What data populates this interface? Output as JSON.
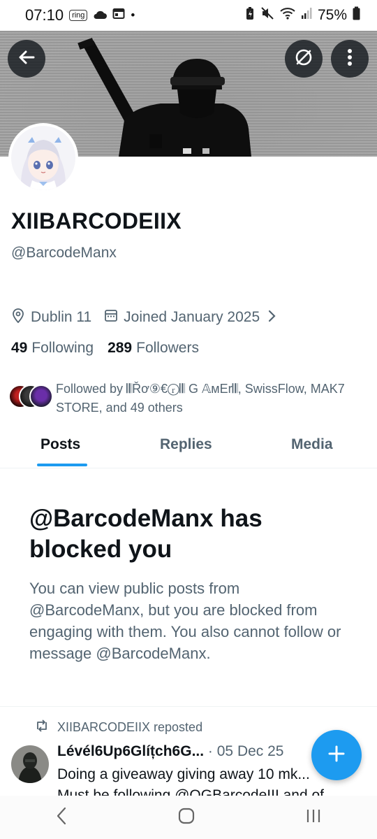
{
  "status_bar": {
    "time": "07:10",
    "ring_badge": "ring",
    "dot": "•",
    "battery": "75%",
    "icons": [
      "cloud-icon",
      "calendar-icon",
      "battery-saver-icon",
      "mute-icon",
      "wifi-icon",
      "signal-icon",
      "battery-icon"
    ]
  },
  "profile": {
    "name": "XIIBARCODEIIX",
    "handle": "@BarcodeManx",
    "location": "Dublin 11",
    "joined": "Joined January 2025",
    "following_count": "49",
    "following_label": "Following",
    "followers_count": "289",
    "followers_label": "Followers",
    "followed_by": "Followed by 𝄃𝄃Řơ⑨€ⓡ𝄃𝄃 G 𝔸мΕr𝄃𝄃, SwissFlow, MAK7 STORE, and 49 others"
  },
  "tabs": [
    "Posts",
    "Replies",
    "Media"
  ],
  "blocked": {
    "title": "@BarcodeManx has blocked you",
    "body": "You can view public posts from @BarcodeManx, but you are blocked from engaging with them. You also cannot follow or message @BarcodeManx."
  },
  "tweet": {
    "reposted_by": "XIIBARCODEIIX reposted",
    "author": "Lévél6Up6Glíțch6G...",
    "date": "· 05 Dec 25",
    "line1": "Doing a giveaway giving away 10 mk...",
    "line2": "Must be following @OGBarcodeIII and of"
  },
  "colors": {
    "accent": "#1d9bf0",
    "text_primary": "#0f1419",
    "text_secondary": "#536471"
  }
}
